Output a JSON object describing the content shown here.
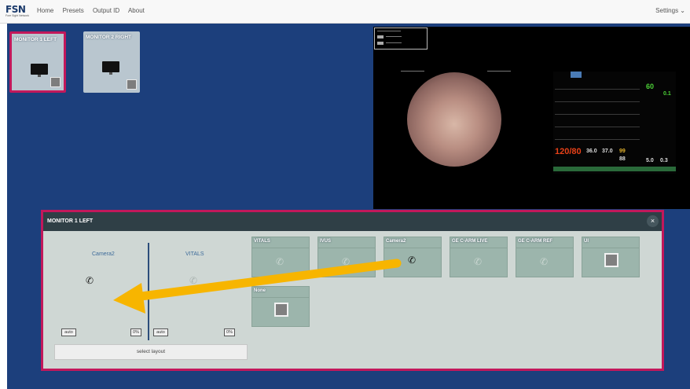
{
  "header": {
    "logo_text": "FSN",
    "logo_subtext": "Fore Sight Network",
    "nav": [
      "Home",
      "Presets",
      "Output ID",
      "About"
    ],
    "settings_label": "Settings ⌄"
  },
  "monitors": [
    {
      "label": "MONITOR 1 LEFT",
      "selected": true
    },
    {
      "label": "MONITOR 2 RIGHT",
      "selected": false
    }
  ],
  "preview": {
    "vitals_values": [
      "60",
      "0.1",
      "120/80",
      "36.0",
      "37.0",
      "99",
      "88",
      "5.0",
      "0.3"
    ]
  },
  "panel": {
    "title": "MONITOR 1 LEFT",
    "close_label": "×",
    "slots": [
      {
        "label": "Camera2",
        "auto_label": "auto",
        "percent": "0%",
        "icon": "camera-icon"
      },
      {
        "label": "VITALS",
        "auto_label": "auto",
        "percent": "0%",
        "icon": "camera-icon"
      }
    ],
    "select_layout_label": "select layout"
  },
  "sources": [
    {
      "label": "VITALS",
      "icon": "camera-icon"
    },
    {
      "label": "IVUS",
      "icon": "camera-icon"
    },
    {
      "label": "Camera2",
      "icon": "camera-icon"
    },
    {
      "label": "GE C-ARM LIVE",
      "icon": "camera-icon"
    },
    {
      "label": "GE C-ARM REF",
      "icon": "camera-icon"
    },
    {
      "label": "UI",
      "icon": "square-icon"
    },
    {
      "label": "None",
      "icon": "square-icon"
    }
  ],
  "colors": {
    "background": "#1c3f7c",
    "selection_border": "#c2185b",
    "arrow": "#f7b500",
    "tile": "#9cb5ac"
  }
}
